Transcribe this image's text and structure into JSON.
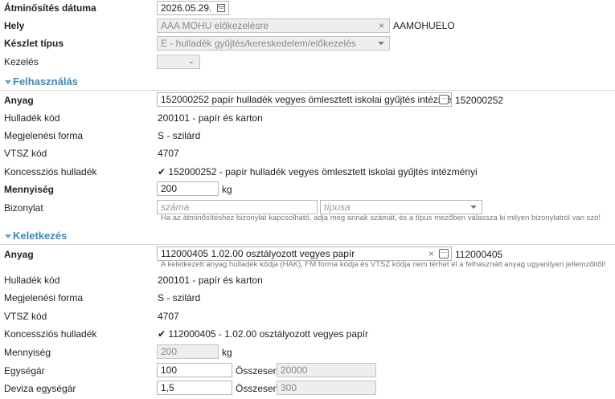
{
  "top": {
    "date_label": "Átminősítés dátuma",
    "date_value": "2026.05.29.",
    "place_label": "Hely",
    "place_value": "AAA MOHU előkezelésre",
    "place_code": "AAMOHUELO",
    "stock_type_label": "Készlet típus",
    "stock_type_value": "E - hulladék gyűjtés/kereskedelem/előkezelés",
    "handling_label": "Kezelés",
    "handling_value": ""
  },
  "usage": {
    "title": "Felhasználás",
    "material_label": "Anyag",
    "material_value": "152000252 papír hulladék vegyes ömlesztett iskolai gyűjtés intézményi",
    "material_code": "152000252",
    "waste_code_label": "Hulladék kód",
    "waste_code_value": "200101 - papír és karton",
    "appearance_label": "Megjelenési forma",
    "appearance_value": "S - szilárd",
    "vtsz_label": "VTSZ kód",
    "vtsz_value": "4707",
    "concession_label": "Koncessziós hulladék",
    "concession_value": "152000252 - papír hulladék vegyes ömlesztett iskolai gyűjtés intézményi",
    "quantity_label": "Mennyiség",
    "quantity_value": "200",
    "quantity_unit": "kg",
    "receipt_label": "Bizonylat",
    "receipt_number_placeholder": "száma",
    "receipt_type_placeholder": "típusa",
    "receipt_hint": "Ha az átminősítéshez bizonylat kapcsolható, adja meg annak számát, és a típus mezőben válassza ki milyen bizonylatról van szó!"
  },
  "origin": {
    "title": "Keletkezés",
    "material_label": "Anyag",
    "material_value": "112000405 1.02.00 osztályozott vegyes papír",
    "material_code": "112000405",
    "material_hint": "A keletkezett anyag hulladék kódja (HAK), FM forma kódja és VTSZ kódja nem térhet el a felhasznált anyag ugyanilyen jellemzőitől!",
    "waste_code_label": "Hulladék kód",
    "waste_code_value": "200101 - papír és karton",
    "appearance_label": "Megjelenési forma",
    "appearance_value": "S - szilárd",
    "vtsz_label": "VTSZ kód",
    "vtsz_value": "4707",
    "concession_label": "Koncessziós hulladék",
    "concession_value": "112000405 - 1.02.00 osztályozott vegyes papír",
    "quantity_label": "Mennyiség",
    "quantity_value": "200",
    "quantity_unit": "kg",
    "unit_price_label": "Egységár",
    "unit_price_value": "100",
    "unit_total_label": "Összesen",
    "unit_total_value": "20000",
    "fx_price_label": "Deviza egységár",
    "fx_price_value": "1,5",
    "fx_total_label": "Összesen",
    "fx_total_value": "300"
  },
  "icons": {
    "check": "✔",
    "clear": "×",
    "ellipsis": "···",
    "chevron": "⌄"
  },
  "colors": {
    "section_title": "#3a8ab8",
    "disabled_bg": "#eeeeee"
  }
}
